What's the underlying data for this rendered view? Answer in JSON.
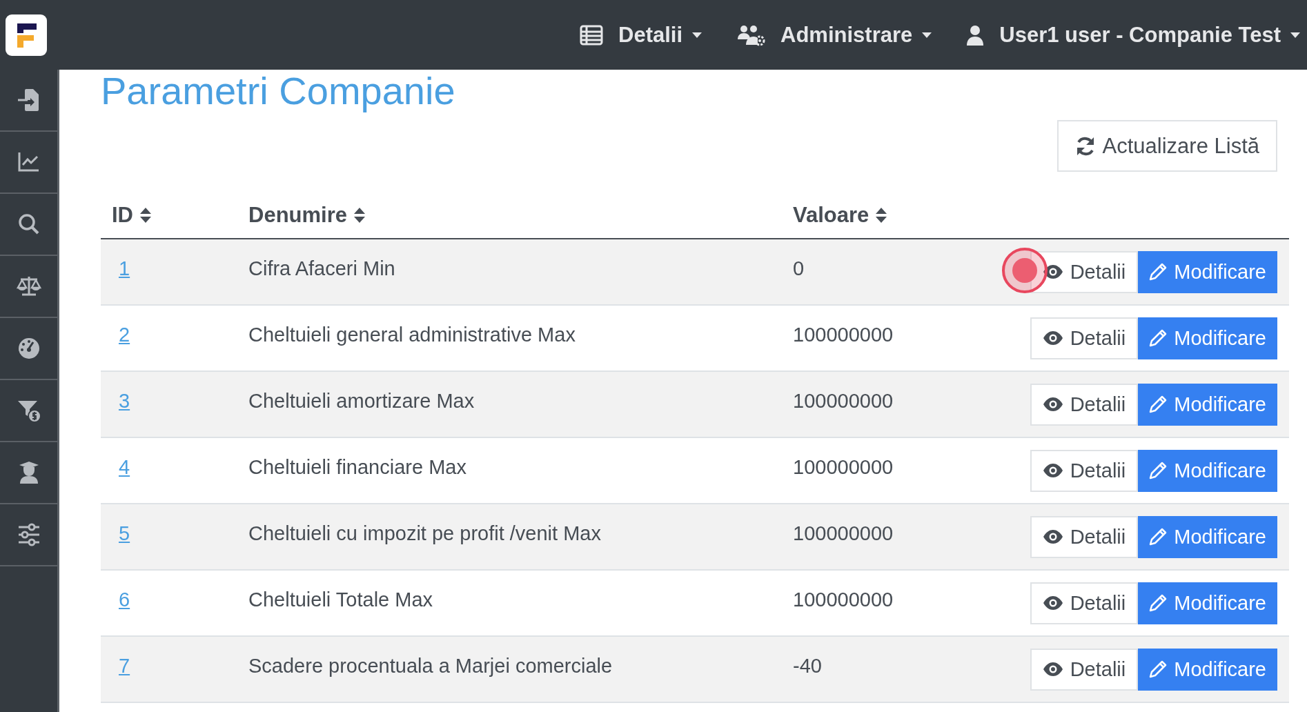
{
  "navbar": {
    "menus": [
      {
        "kind": "list",
        "label": "Detalii"
      },
      {
        "kind": "users",
        "label": "Administrare"
      },
      {
        "kind": "user",
        "label": "User1 user - Companie Test"
      }
    ]
  },
  "page": {
    "title": "Parametri Companie",
    "refresh_button": "Actualizare Listă"
  },
  "table": {
    "columns": [
      "ID",
      "Denumire",
      "Valoare"
    ],
    "rows": [
      {
        "id": "1",
        "name": "Cifra Afaceri Min",
        "value": "0",
        "details_button": "Detalii",
        "edit_button": "Modificare"
      },
      {
        "id": "2",
        "name": "Cheltuieli general administrative Max",
        "value": "100000000",
        "details_button": "Detalii",
        "edit_button": "Modificare"
      },
      {
        "id": "3",
        "name": "Cheltuieli amortizare Max",
        "value": "100000000",
        "details_button": "Detalii",
        "edit_button": "Modificare"
      },
      {
        "id": "4",
        "name": "Cheltuieli financiare Max",
        "value": "100000000",
        "details_button": "Detalii",
        "edit_button": "Modificare"
      },
      {
        "id": "5",
        "name": "Cheltuieli cu impozit pe profit /venit Max",
        "value": "100000000",
        "details_button": "Detalii",
        "edit_button": "Modificare"
      },
      {
        "id": "6",
        "name": "Cheltuieli Totale Max",
        "value": "100000000",
        "details_button": "Detalii",
        "edit_button": "Modificare"
      },
      {
        "id": "7",
        "name": "Scadere procentuala a Marjei comerciale",
        "value": "-40",
        "details_button": "Detalii",
        "edit_button": "Modificare"
      }
    ]
  }
}
